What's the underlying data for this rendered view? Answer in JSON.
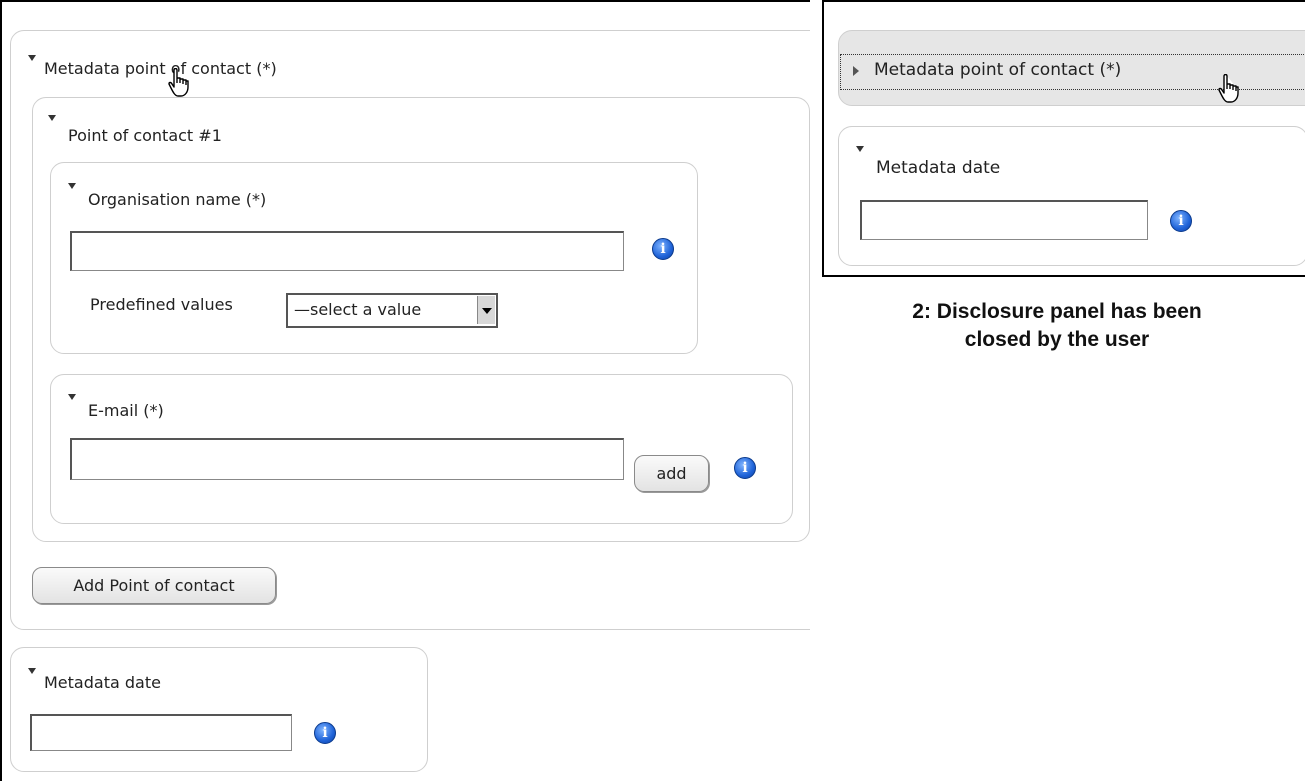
{
  "screenshot1": {
    "metadata_poc": {
      "title": "Metadata point of contact (*)",
      "poc": {
        "title": "Point of contact #1",
        "org": {
          "title": "Organisation name (*)",
          "value": "",
          "predefined_label": "Predefined values",
          "select_value": "—select a value"
        },
        "email": {
          "title": "E-mail (*)",
          "value": "",
          "add_label": "add"
        }
      },
      "add_poc_label": "Add Point of contact"
    },
    "metadata_date": {
      "title": "Metadata date",
      "value": ""
    },
    "info_glyph": "i"
  },
  "screenshot2": {
    "collapsed_title": "Metadata point of contact (*)",
    "metadata_date": {
      "title": "Metadata date",
      "value": ""
    },
    "info_glyph": "i"
  },
  "caption": {
    "line1": "2: Disclosure panel has been",
    "line2": "closed by the user"
  },
  "icons": [
    "expand-triangle-icon",
    "collapse-triangle-icon",
    "info-icon",
    "hand-cursor-icon",
    "dropdown-arrow-icon"
  ]
}
